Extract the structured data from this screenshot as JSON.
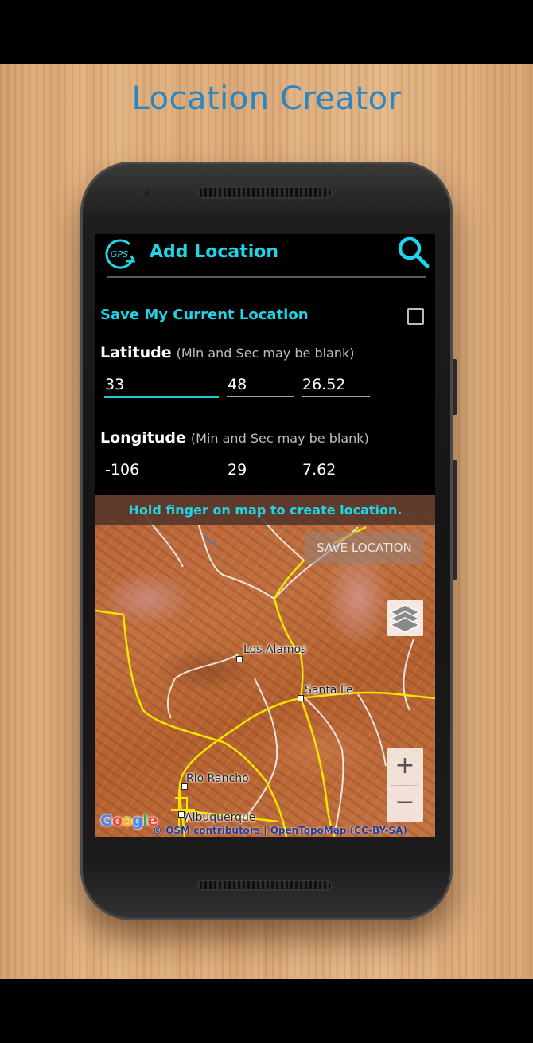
{
  "promo": {
    "title": "Location Creator"
  },
  "appbar": {
    "title": "Add Location",
    "logo_text": "GPS",
    "icons": [
      "gps-logo-icon",
      "search-icon"
    ]
  },
  "form": {
    "save_current_label": "Save My Current Location",
    "save_current_checked": false,
    "latitude": {
      "label": "Latitude",
      "hint": "(Min and Sec may be blank)",
      "deg": "33",
      "min": "48",
      "sec": "26.52"
    },
    "longitude": {
      "label": "Longitude",
      "hint": "(Min and Sec may be blank)",
      "deg": "-106",
      "min": "29",
      "sec": "7.62"
    }
  },
  "map": {
    "banner": "Hold finger on map to create location.",
    "save_button": "SAVE LOCATION",
    "zoom_in": "+",
    "zoom_out": "−",
    "places": [
      "Los Alamos",
      "Santa Fe",
      "Rio Rancho",
      "Albuquerque"
    ],
    "google": "Google",
    "attribution": "© OSM contributors | OpenTopoMap (CC-BY-SA)"
  },
  "colors": {
    "accent": "#21d4e6",
    "headline": "#2a86c3",
    "map_terrain": "#c2703f"
  }
}
